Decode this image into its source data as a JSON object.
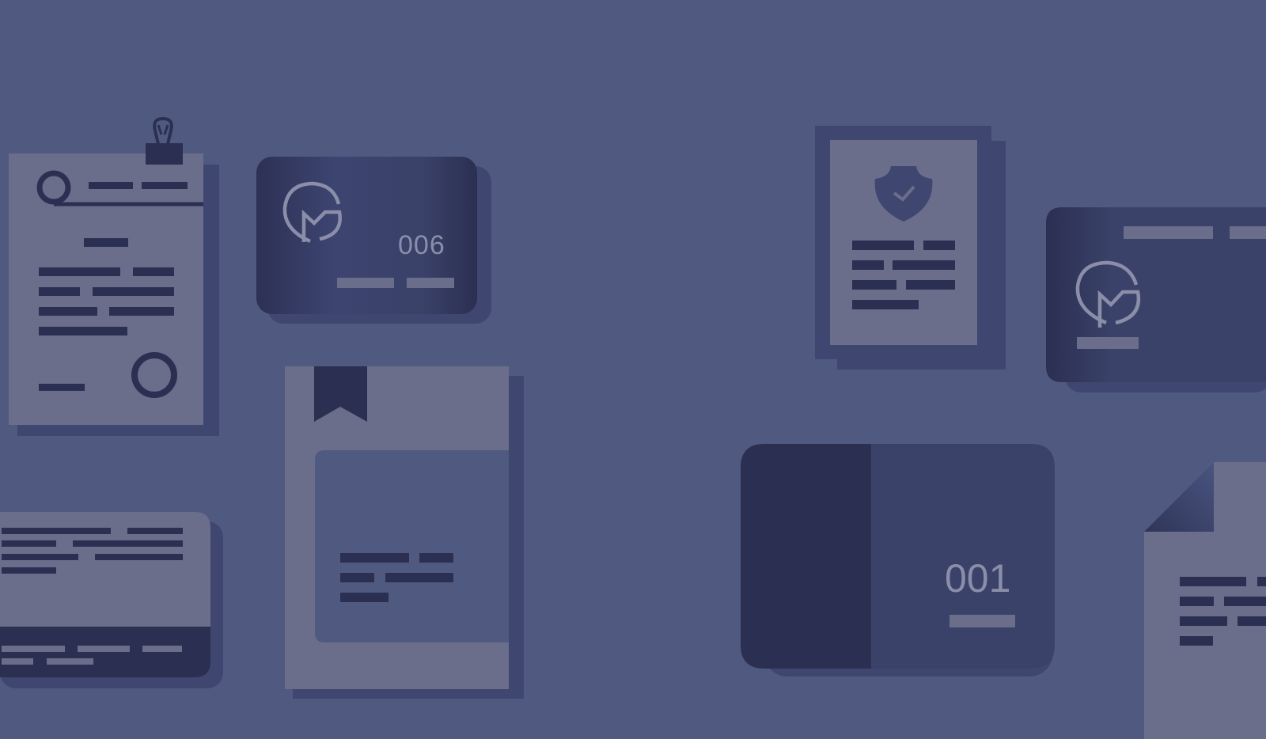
{
  "colors": {
    "background": "#505a80",
    "paper": "#6a6e8b",
    "paper_shadow": "#3f4670",
    "dark": "#2b2f52",
    "card_mid": "#3a4269",
    "light_accent": "#8a8ea8"
  },
  "illustration": {
    "card_small_number": "006",
    "card_large_number": "001"
  },
  "icons": [
    "binder-clip-icon",
    "logo-emblem-icon",
    "bookmark-icon",
    "shield-check-icon"
  ]
}
